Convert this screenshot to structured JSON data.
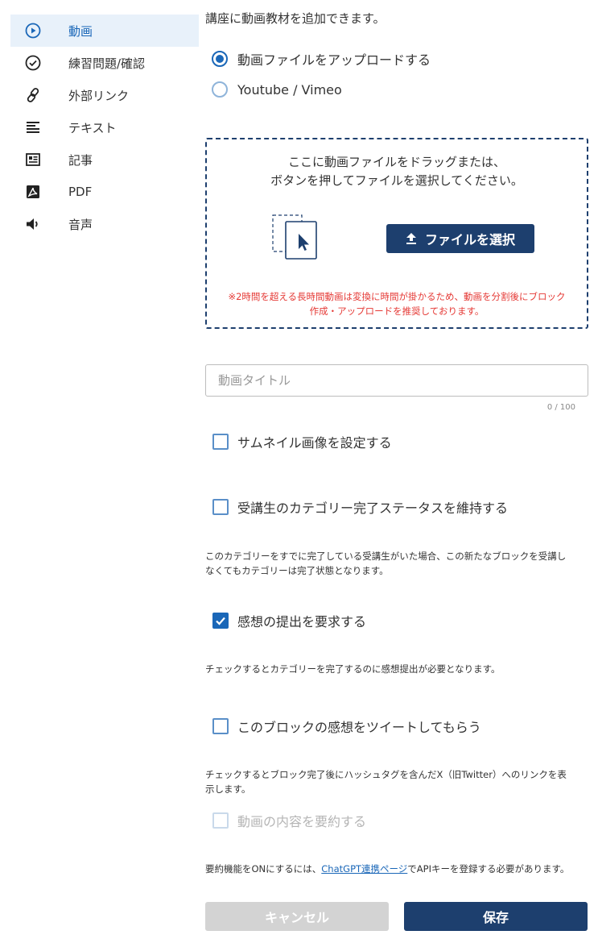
{
  "sidebar": {
    "items": [
      {
        "label": "動画",
        "icon": "play-circle-icon",
        "active": true
      },
      {
        "label": "練習問題/確認",
        "icon": "check-circle-icon"
      },
      {
        "label": "外部リンク",
        "icon": "link-icon"
      },
      {
        "label": "テキスト",
        "icon": "text-lines-icon"
      },
      {
        "label": "記事",
        "icon": "article-icon"
      },
      {
        "label": "PDF",
        "icon": "pdf-icon"
      },
      {
        "label": "音声",
        "icon": "speaker-icon"
      }
    ]
  },
  "main": {
    "intro": "講座に動画教材を追加できます。",
    "source_options": [
      {
        "label": "動画ファイルをアップロードする",
        "selected": true
      },
      {
        "label": "Youtube / Vimeo",
        "selected": false
      }
    ],
    "dropzone": {
      "line1": "ここに動画ファイルをドラッグまたは、",
      "line2": "ボタンを押してファイルを選択してください。",
      "button_label": "ファイルを選択",
      "note_line1": "※2時間を超える長時間動画は変換に時間が掛かるため、動画を分割後にブロック",
      "note_line2": "作成・アップロードを推奨しております。"
    },
    "title_input": {
      "placeholder": "動画タイトル",
      "value": "",
      "counter": "0 / 100"
    },
    "thumbnail_label": "サムネイル画像を設定する",
    "keep_status": {
      "label": "受講生のカテゴリー完了ステータスを維持する",
      "help_line1": "このカテゴリーをすでに完了している受講生がいた場合、この新たなブロックを受講し",
      "help_line2": "なくてもカテゴリーは完了状態となります。"
    },
    "feedback": {
      "label": "感想の提出を要求する",
      "checked": true,
      "help": "チェックするとカテゴリーを完了するのに感想提出が必要となります。"
    },
    "tweet": {
      "label": "このブロックの感想をツイートしてもらう",
      "help_line1": "チェックするとブロック完了後にハッシュタグを含んだX（旧Twitter）へのリンクを表",
      "help_line2": "示します。"
    },
    "summary": {
      "label": "動画の内容を要約する",
      "disabled": true,
      "help_prefix": "要約機能をONにするには、",
      "help_link": "ChatGPT連携ページ",
      "help_suffix": "でAPIキーを登録する必要があります。"
    },
    "actions": {
      "cancel": "キャンセル",
      "save": "保存"
    }
  },
  "colors": {
    "accent": "#1a67b8",
    "navy": "#1d3f6e",
    "warning": "#e53935",
    "active_bg": "#e8f1fa",
    "disabled_btn": "#d3d3d3"
  }
}
